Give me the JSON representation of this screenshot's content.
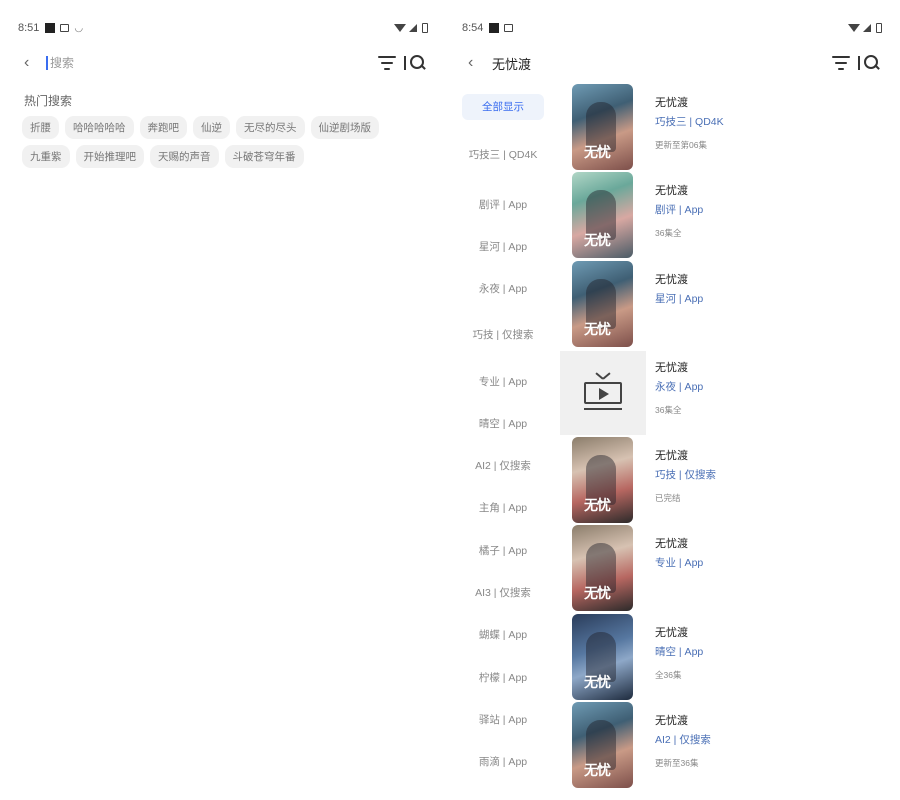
{
  "left_screen": {
    "status_bar": {
      "time": "8:51"
    },
    "search": {
      "placeholder": "搜索"
    },
    "hot_search": {
      "title": "热门搜索",
      "tags": [
        "折腰",
        "哈哈哈哈哈",
        "奔跑吧",
        "仙逆",
        "无尽的尽头",
        "仙逆剧场版",
        "九重紫",
        "开始推理吧",
        "天赐的声音",
        "斗破苍穹年番"
      ]
    }
  },
  "right_screen": {
    "status_bar": {
      "time": "8:54"
    },
    "title": "无忧渡",
    "categories": [
      "全部显示",
      "巧技三 | QD4K",
      "剧评 | App",
      "星河 | App",
      "永夜 | App",
      "巧技 | 仅搜索",
      "专业 | App",
      "晴空 | App",
      "AI2 | 仅搜索",
      "主角 | App",
      "橘子 | App",
      "AI3 | 仅搜索",
      "蝴蝶 | App",
      "柠檬 | App",
      "驿站 | App",
      "雨滴 | App"
    ],
    "results": [
      {
        "title": "无忧渡",
        "source": "巧技三 | QD4K",
        "status": "更新至第06集",
        "poster": "drama-poster"
      },
      {
        "title": "无忧渡",
        "source": "剧评 | App",
        "status": "36集全",
        "poster": "drama-poster"
      },
      {
        "title": "无忧渡",
        "source": "星河 | App",
        "status": "",
        "poster": "drama-poster"
      },
      {
        "title": "无忧渡",
        "source": "永夜 | App",
        "status": "36集全",
        "poster": "tv-icon"
      },
      {
        "title": "无忧渡",
        "source": "巧技 | 仅搜索",
        "status": "已完结",
        "poster": "drama-poster"
      },
      {
        "title": "无忧渡",
        "source": "专业 | App",
        "status": "",
        "poster": "drama-poster"
      },
      {
        "title": "无忧渡",
        "source": "晴空 | App",
        "status": "全36集",
        "poster": "drama-poster"
      },
      {
        "title": "无忧渡",
        "source": "AI2 | 仅搜索",
        "status": "更新至36集",
        "poster": "drama-poster"
      }
    ]
  }
}
